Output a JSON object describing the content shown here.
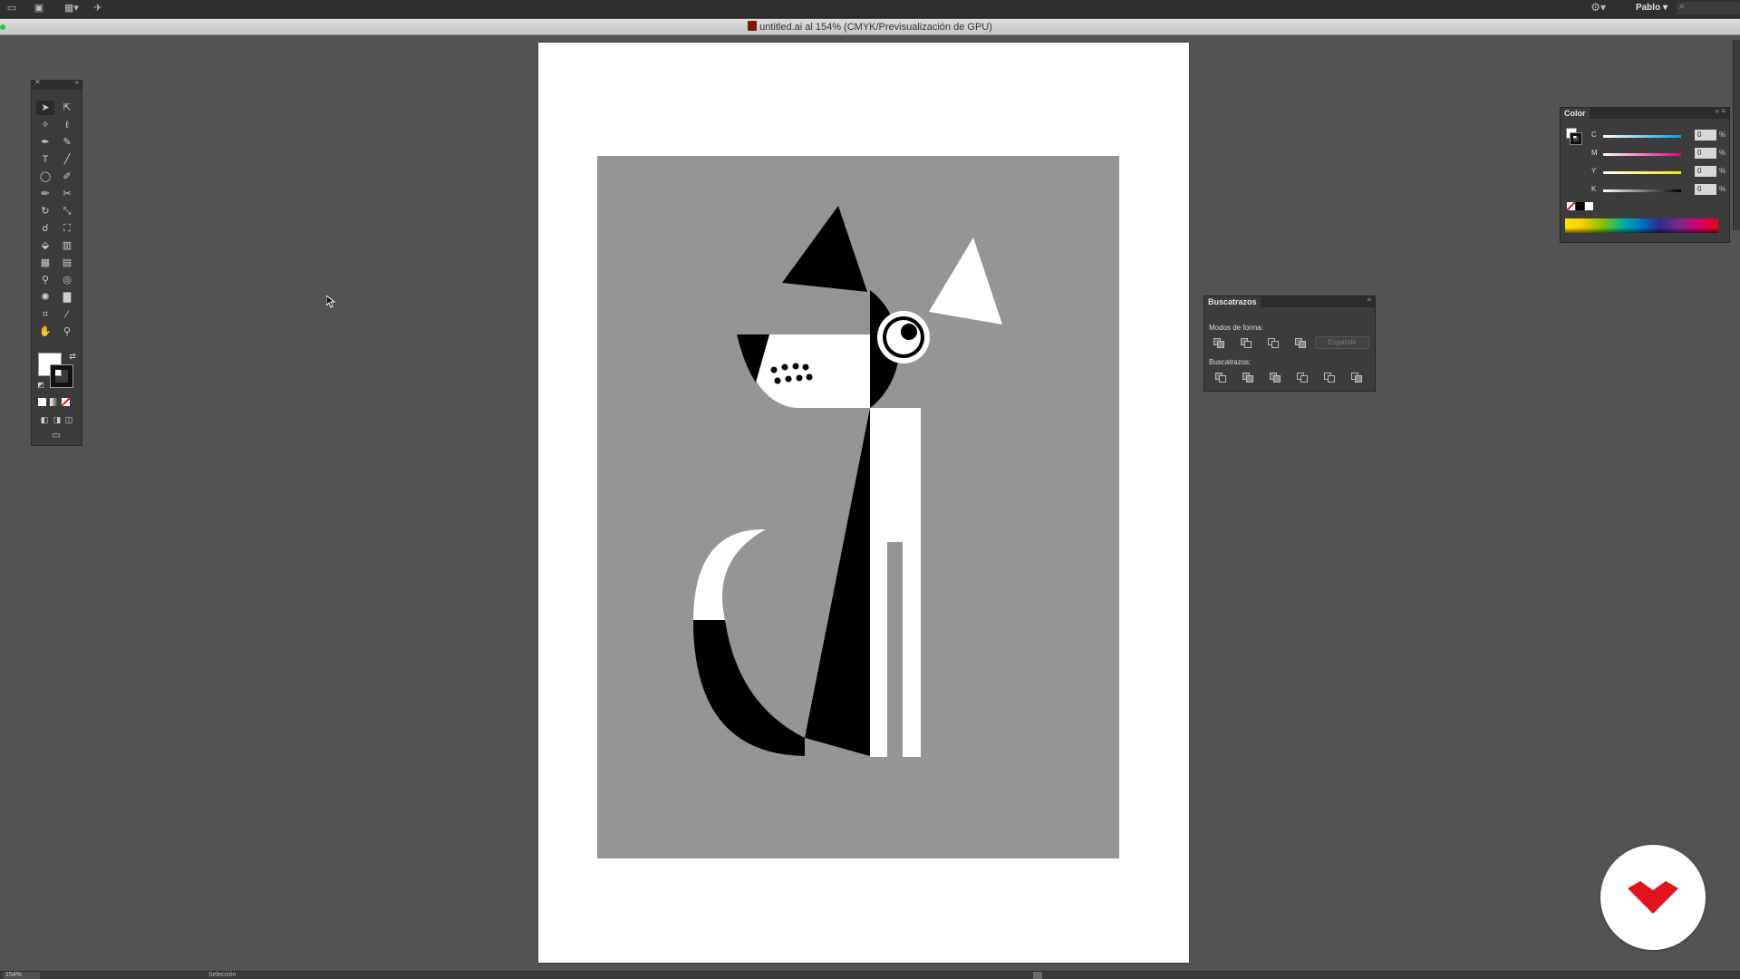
{
  "app": {
    "user_name": "Pablo",
    "document_title": "untitled.ai al 154% (CMYK/Previsualización de GPU)"
  },
  "color_panel": {
    "tab_label": "Color",
    "channels": [
      {
        "label": "C",
        "value": "0",
        "unit": "%",
        "color": "#00a0e3"
      },
      {
        "label": "M",
        "value": "0",
        "unit": "%",
        "color": "#e4007f"
      },
      {
        "label": "Y",
        "value": "0",
        "unit": "%",
        "color": "#ffe400"
      },
      {
        "label": "K",
        "value": "0",
        "unit": "%",
        "color": "#000000"
      }
    ]
  },
  "pathfinder_panel": {
    "tab_label": "Buscatrazos",
    "shape_modes_label": "Modos de forma:",
    "expand_label": "Expandir",
    "pathfinders_label": "Buscatrazos:"
  },
  "status": {
    "zoom": "154%",
    "mode": "Selección"
  },
  "colors": {
    "workspace": "#535353",
    "artboard": "#ffffff",
    "art_background": "#959595",
    "art_black": "#000000",
    "art_white": "#ffffff",
    "brand_red": "#e3121b"
  },
  "icons": [
    "selection-tool-icon",
    "direct-selection-tool-icon",
    "magic-wand-icon",
    "lasso-icon",
    "pen-tool-icon",
    "curvature-tool-icon",
    "type-tool-icon",
    "line-tool-icon",
    "ellipse-tool-icon",
    "brush-tool-icon",
    "pencil-tool-icon",
    "scissors-icon",
    "rotate-tool-icon",
    "scale-tool-icon",
    "warp-tool-icon",
    "free-transform-icon",
    "shape-builder-icon",
    "chart-tool-icon",
    "mesh-tool-icon",
    "gradient-tool-icon",
    "eyedropper-icon",
    "blend-tool-icon",
    "symbol-sprayer-icon",
    "column-graph-icon",
    "artboard-tool-icon",
    "slice-tool-icon",
    "hand-tool-icon",
    "zoom-tool-icon"
  ]
}
